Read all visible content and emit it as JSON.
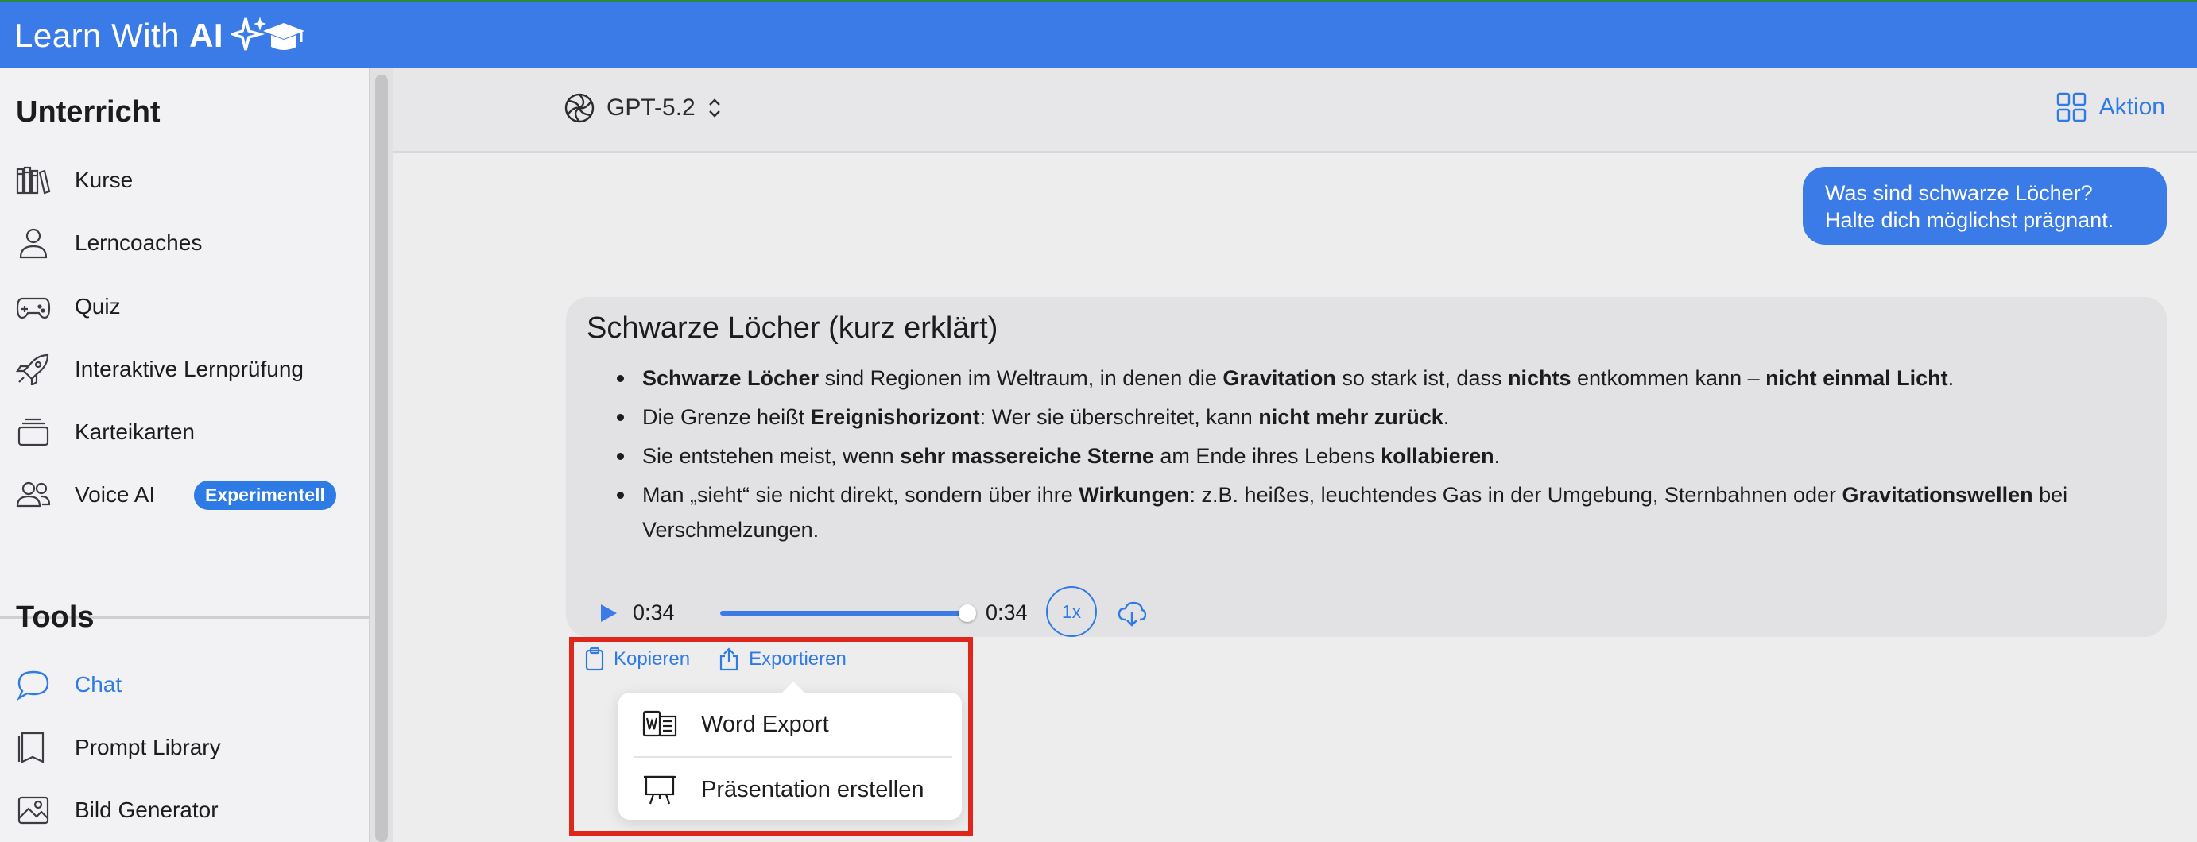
{
  "app": {
    "title_prefix": "Learn With",
    "title_bold": "AI"
  },
  "sidebar": {
    "section1_title": "Unterricht",
    "section1_items": [
      {
        "label": "Kurse",
        "icon": "books-icon"
      },
      {
        "label": "Lerncoaches",
        "icon": "person-icon"
      },
      {
        "label": "Quiz",
        "icon": "gamecontroller-icon"
      },
      {
        "label": "Interaktive Lernprüfung",
        "icon": "rocket-icon"
      },
      {
        "label": "Karteikarten",
        "icon": "cards-stack-icon"
      },
      {
        "label": "Voice AI",
        "icon": "people-icon",
        "badge": "Experimentell"
      }
    ],
    "section2_title": "Tools",
    "section2_items": [
      {
        "label": "Chat",
        "icon": "chat-bubble-icon",
        "active": true
      },
      {
        "label": "Prompt Library",
        "icon": "book-icon"
      },
      {
        "label": "Bild Generator",
        "icon": "image-icon"
      }
    ]
  },
  "header": {
    "model": "GPT-5.2",
    "action": "Aktion"
  },
  "chat": {
    "user_message_line1": "Was sind schwarze Löcher?",
    "user_message_line2": "Halte dich möglichst prägnant.",
    "answer_title": "Schwarze Löcher (kurz erklärt)",
    "bullets": [
      [
        [
          "b",
          "Schwarze Löcher"
        ],
        [
          "t",
          " sind Regionen im Weltraum, in denen die "
        ],
        [
          "b",
          "Gravitation"
        ],
        [
          "t",
          " so stark ist, dass "
        ],
        [
          "b",
          "nichts"
        ],
        [
          "t",
          " entkommen kann – "
        ],
        [
          "b",
          "nicht einmal Licht"
        ],
        [
          "t",
          "."
        ]
      ],
      [
        [
          "t",
          "Die Grenze heißt "
        ],
        [
          "b",
          "Ereignishorizont"
        ],
        [
          "t",
          ": Wer sie überschreitet, kann "
        ],
        [
          "b",
          "nicht mehr zurück"
        ],
        [
          "t",
          "."
        ]
      ],
      [
        [
          "t",
          "Sie entstehen meist, wenn "
        ],
        [
          "b",
          "sehr massereiche Sterne"
        ],
        [
          "t",
          " am Ende ihres Lebens "
        ],
        [
          "b",
          "kollabieren"
        ],
        [
          "t",
          "."
        ]
      ],
      [
        [
          "t",
          "Man „sieht“ sie nicht direkt, sondern über ihre "
        ],
        [
          "b",
          "Wirkungen"
        ],
        [
          "t",
          ": z.B. heißes, leuchtendes Gas in der Umgebung, Sternbahnen oder "
        ],
        [
          "b",
          "Gravitationswellen"
        ],
        [
          "t",
          " bei Verschmelzungen."
        ]
      ]
    ],
    "audio": {
      "current": "0:34",
      "total": "0:34",
      "speed": "1x",
      "progress": 1.0
    },
    "copy_label": "Kopieren",
    "export_label": "Exportieren",
    "export_menu": [
      {
        "label": "Word Export",
        "icon": "word-doc-icon"
      },
      {
        "label": "Präsentation erstellen",
        "icon": "presentation-easel-icon"
      }
    ]
  },
  "colors": {
    "accent": "#3a7be8",
    "highlight": "#e0261a"
  }
}
